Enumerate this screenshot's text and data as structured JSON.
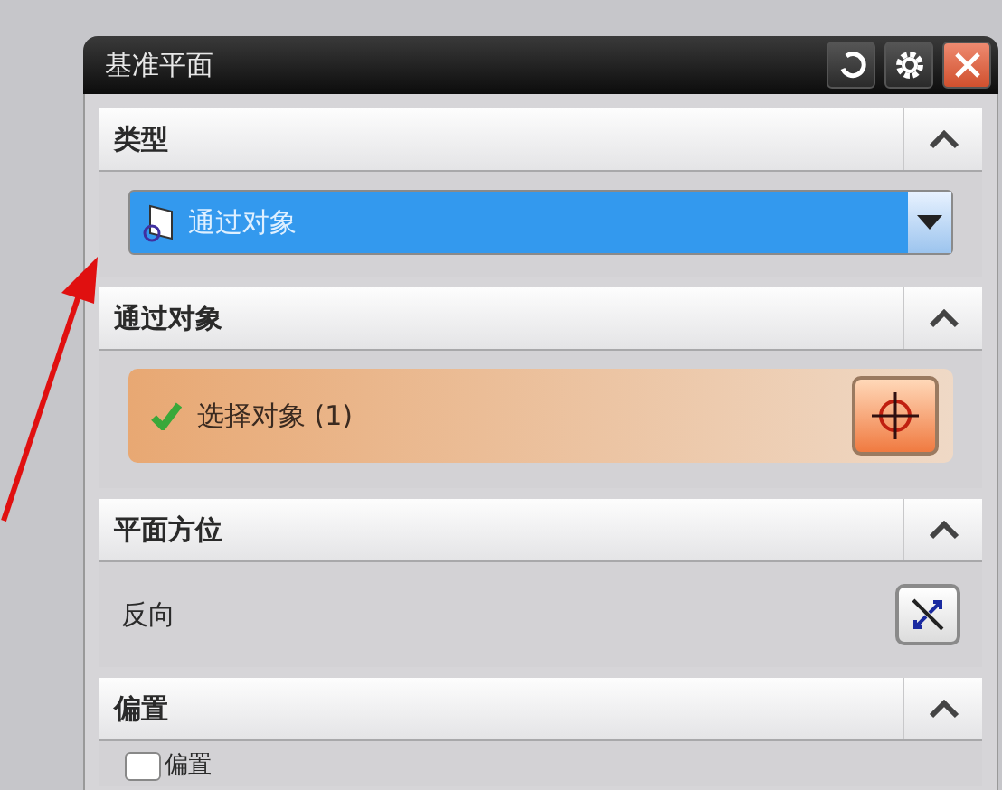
{
  "window": {
    "title": "基准平面"
  },
  "sections": [
    {
      "title": "类型",
      "expanded": true,
      "kind": "dropdown",
      "value": "通过对象"
    },
    {
      "title": "通过对象",
      "expanded": true,
      "kind": "selection",
      "label": "选择对象 (1)",
      "complete": true
    },
    {
      "title": "平面方位",
      "expanded": true,
      "kind": "action",
      "label": "反向"
    },
    {
      "title": "偏置",
      "expanded": true,
      "kind": "checkbox",
      "label": "偏置",
      "checked": false
    }
  ]
}
